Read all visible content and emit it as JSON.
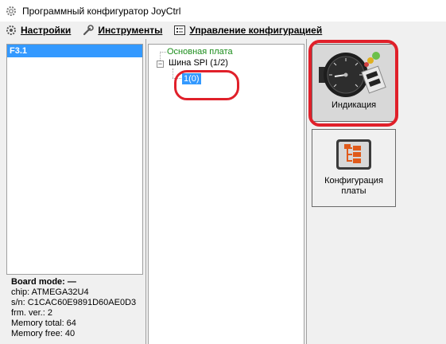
{
  "window": {
    "title": "Программный конфигуратор JoyCtrl"
  },
  "menu": {
    "settings": "Настройки",
    "tools": "Инструменты",
    "config_management": "Управление конфигурацией"
  },
  "device_list": {
    "items": [
      "F3.1"
    ]
  },
  "board": {
    "mode": "Board mode: —",
    "chip": "chip: ATMEGA32U4",
    "serial": "s/n: C1CAC60E9891D60AE0D3",
    "firmware": "frm. ver.: 2",
    "memory_total": "Memory total: 64",
    "memory_free": "Memory free: 40"
  },
  "tree": {
    "main_board": "Основная плата",
    "spi_bus": "Шина SPI (1/2)",
    "child": "1(0)",
    "expander": "−"
  },
  "tiles": {
    "indication": "Индикация",
    "board_config": "Конфигурация платы"
  },
  "colors": {
    "selection": "#3399ff",
    "annotation": "#e0202a",
    "main_board_text": "#1a8c1a"
  }
}
